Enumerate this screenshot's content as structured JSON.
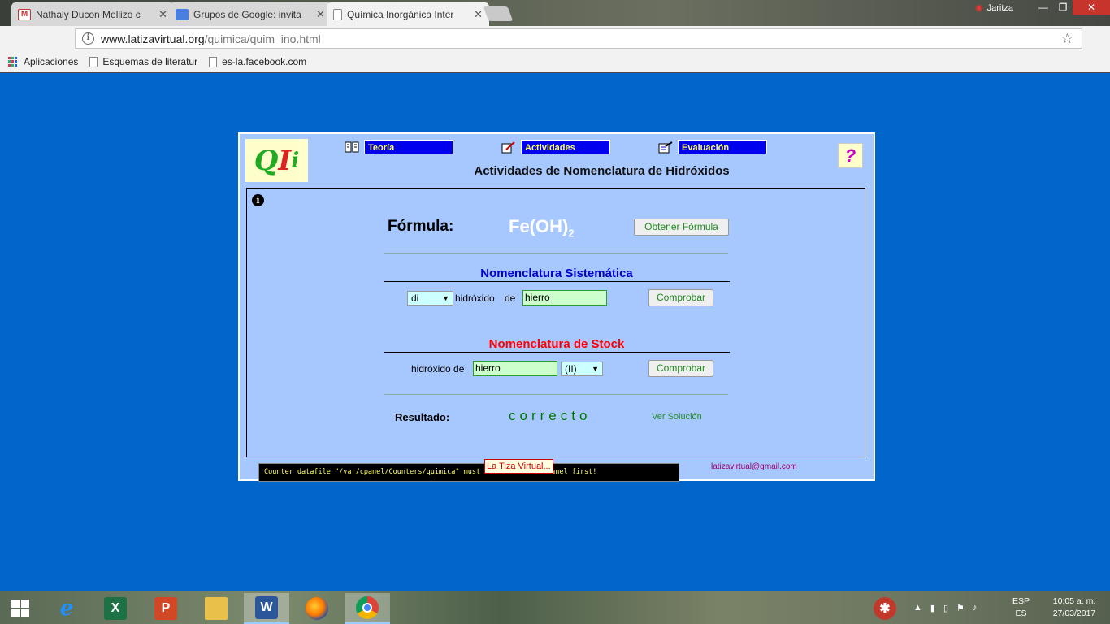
{
  "browser": {
    "tabs": [
      {
        "title": "Nathaly Ducon Mellizo c",
        "icon": "gmail-icon",
        "active": false
      },
      {
        "title": "Grupos de Google: invita",
        "icon": "google-groups-icon",
        "active": false
      },
      {
        "title": "Química Inorgánica Inter",
        "icon": "page-icon",
        "active": true
      }
    ],
    "profile_name": "Jaritza",
    "url_host": "www.latizavirtual.org",
    "url_path": "/quimica/quim_ino.html",
    "bookmarks": [
      {
        "label": "Aplicaciones",
        "icon": "apps-icon"
      },
      {
        "label": "Esquemas de literatur",
        "icon": "page-icon"
      },
      {
        "label": "es-la.facebook.com",
        "icon": "page-icon"
      }
    ]
  },
  "page": {
    "logo": {
      "q": "Q",
      "i1": "I",
      "i2": "i"
    },
    "nav": [
      {
        "label": "Teoría",
        "icon": "book-icon"
      },
      {
        "label": "Actividades",
        "icon": "pencil-icon"
      },
      {
        "label": "Evaluación",
        "icon": "notepad-icon"
      }
    ],
    "help_label": "?",
    "title": "Actividades de Nomenclatura de Hidróxidos",
    "info_glyph": "i",
    "formula": {
      "label": "Fórmula:",
      "value_main": "Fe(OH)",
      "value_sub": "2",
      "button": "Obtener Fórmula"
    },
    "systematic": {
      "title": "Nomenclatura Sistemática",
      "prefix_value": "di",
      "word1": "hidróxido",
      "word2": "de",
      "element_value": "hierro",
      "button": "Comprobar"
    },
    "stock": {
      "title": "Nomenclatura de Stock",
      "word": "hidróxido de",
      "element_value": "hierro",
      "valence_value": "(II)",
      "button": "Comprobar"
    },
    "result": {
      "label": "Resultado:",
      "value": "correcto",
      "solution_link": "Ver Solución"
    },
    "email": "latizavirtual@gmail.com",
    "counter_text": "Counter datafile \"/var/cpanel/Counters/quimica\" must be created in cPanel first!",
    "tooltip": "La Tiza Virtual..."
  },
  "taskbar": {
    "apps": [
      {
        "name": "internet-explorer",
        "icon": "ie-icon"
      },
      {
        "name": "excel",
        "icon": "excel-icon"
      },
      {
        "name": "powerpoint",
        "icon": "powerpoint-icon"
      },
      {
        "name": "file-explorer",
        "icon": "folder-icon"
      },
      {
        "name": "word",
        "icon": "word-icon"
      },
      {
        "name": "firefox",
        "icon": "firefox-icon"
      },
      {
        "name": "chrome",
        "icon": "chrome-icon",
        "active": true
      }
    ],
    "lang_top": "ESP",
    "lang_bottom": "ES",
    "time": "10:05 a. m.",
    "date": "27/03/2017"
  }
}
